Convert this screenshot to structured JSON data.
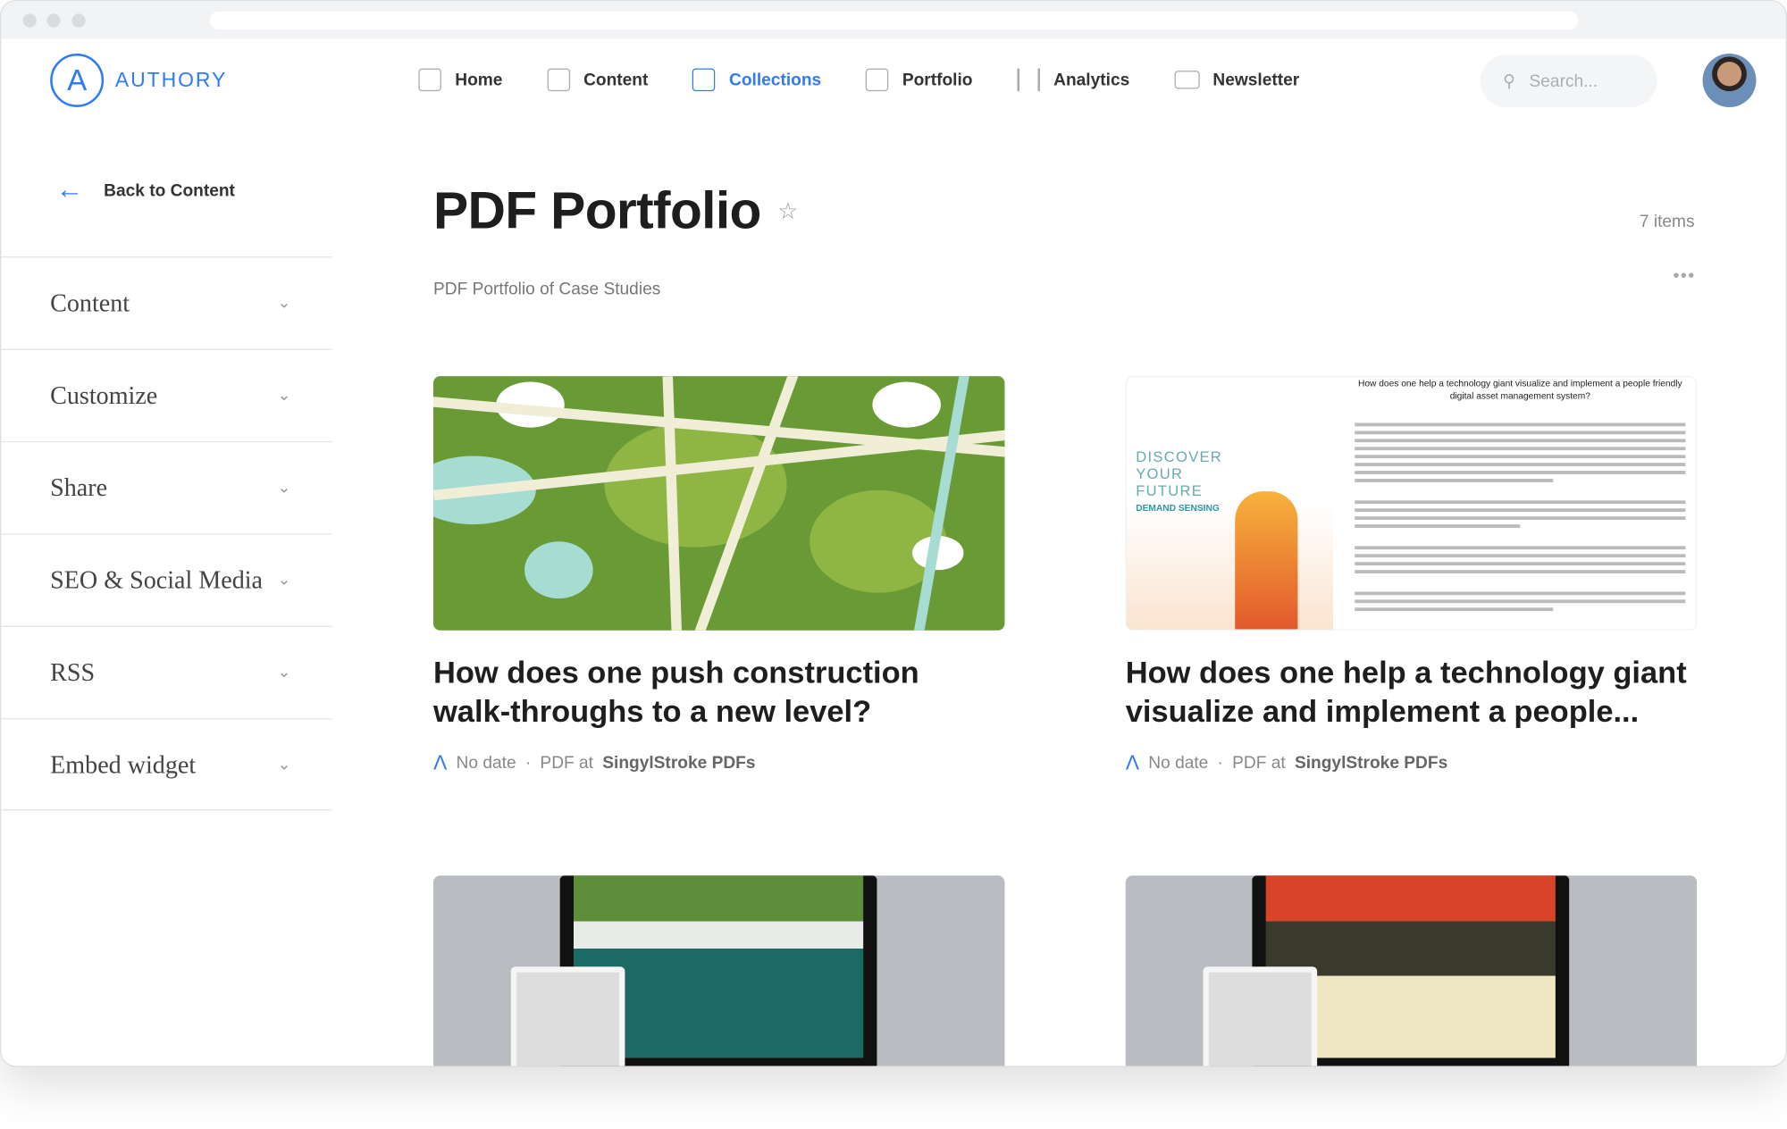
{
  "header": {
    "brand": "AUTHORY",
    "nav": [
      {
        "label": "Home",
        "icon": "home-icon"
      },
      {
        "label": "Content",
        "icon": "content-icon"
      },
      {
        "label": "Collections",
        "icon": "collections-icon",
        "active": true
      },
      {
        "label": "Portfolio",
        "icon": "portfolio-icon"
      },
      {
        "label": "Analytics",
        "icon": "analytics-icon"
      },
      {
        "label": "Newsletter",
        "icon": "newsletter-icon"
      }
    ],
    "search_placeholder": "Search...",
    "accent": "#2f7bf5"
  },
  "sidebar": {
    "back": "Back to Content",
    "items": [
      "Content",
      "Customize",
      "Share",
      "SEO & Social Media",
      "RSS",
      "Embed widget"
    ]
  },
  "main": {
    "title": "PDF Portfolio",
    "count": "7 items",
    "subtitle": "PDF Portfolio of Case Studies",
    "cards": [
      {
        "title": "How does one push construction walk-throughs to a new level?",
        "date": "No date",
        "type": "PDF at",
        "source": "SingylStroke PDFs"
      },
      {
        "title": "How does one help a technology giant visualize and implement a people...",
        "date": "No date",
        "type": "PDF at",
        "source": "SingylStroke PDFs",
        "thumb_heading": "How does one help a technology giant visualize and implement a people friendly digital asset management system?",
        "thumb_cover": "DISCOVER YOUR FUTURE",
        "thumb_sub": "DEMAND SENSING"
      },
      {},
      {}
    ]
  }
}
